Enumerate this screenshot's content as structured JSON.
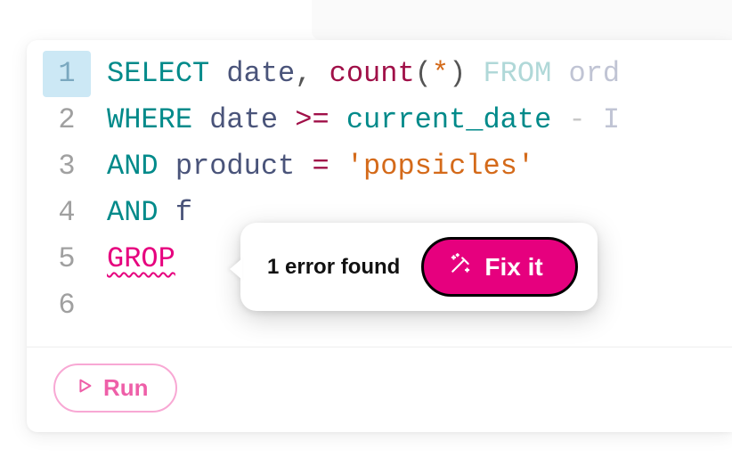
{
  "editor": {
    "lines": {
      "1": {
        "no": "1"
      },
      "2": {
        "no": "2"
      },
      "3": {
        "no": "3"
      },
      "4": {
        "no": "4"
      },
      "5": {
        "no": "5"
      },
      "6": {
        "no": "6"
      }
    },
    "tokens": {
      "l1_select": "SELECT",
      "l1_date": "date",
      "l1_comma": ",",
      "l1_count": "count",
      "l1_lp": "(",
      "l1_star": "*",
      "l1_rp": ")",
      "l1_from": "FROM",
      "l1_ord": "ord",
      "l2_where": "WHERE",
      "l2_date": "date",
      "l2_gte": ">=",
      "l2_curdate": "current_date",
      "l2_minus": "-",
      "l2_I": "I",
      "l3_and": "AND",
      "l3_product": "product",
      "l3_eq": "=",
      "l3_str": "'popsicles'",
      "l4_and": "AND",
      "l4_f": "f",
      "l5_grop": "GROP"
    }
  },
  "error_popup": {
    "message": "1 error found",
    "fix_label": "Fix it"
  },
  "footer": {
    "run_label": "Run"
  }
}
